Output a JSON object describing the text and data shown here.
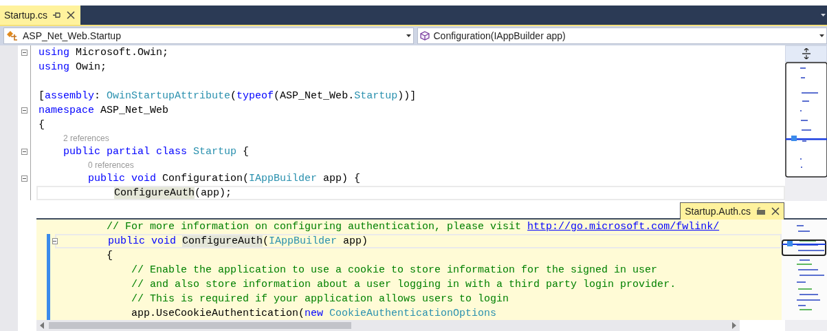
{
  "tabs": [
    {
      "label": "Startup.cs",
      "selected": true,
      "pinned": false
    }
  ],
  "navigation": {
    "type_dropdown": "ASP_Net_Web.Startup",
    "member_dropdown": "Configuration(IAppBuilder app)"
  },
  "editor": {
    "lines": [
      {
        "kind": "code",
        "fold": true,
        "current": false,
        "tokens": [
          {
            "kind": "keyword",
            "text": "using"
          },
          {
            "kind": "plain",
            "text": " Microsoft.Owin;"
          }
        ]
      },
      {
        "kind": "code",
        "fold": false,
        "current": false,
        "tokens": [
          {
            "kind": "keyword",
            "text": "using"
          },
          {
            "kind": "plain",
            "text": " Owin;"
          }
        ]
      },
      {
        "kind": "blank"
      },
      {
        "kind": "code",
        "fold": false,
        "current": false,
        "tokens": [
          {
            "kind": "plain",
            "text": "["
          },
          {
            "kind": "keyword",
            "text": "assembly"
          },
          {
            "kind": "plain",
            "text": ": "
          },
          {
            "kind": "type",
            "text": "OwinStartupAttribute"
          },
          {
            "kind": "plain",
            "text": "("
          },
          {
            "kind": "keyword",
            "text": "typeof"
          },
          {
            "kind": "plain",
            "text": "(ASP_Net_Web."
          },
          {
            "kind": "type",
            "text": "Startup"
          },
          {
            "kind": "plain",
            "text": "))]"
          }
        ]
      },
      {
        "kind": "code",
        "fold": true,
        "current": false,
        "tokens": [
          {
            "kind": "keyword",
            "text": "namespace"
          },
          {
            "kind": "plain",
            "text": " ASP_Net_Web"
          }
        ]
      },
      {
        "kind": "code",
        "fold": false,
        "current": false,
        "tokens": [
          {
            "kind": "plain",
            "text": "{"
          }
        ]
      },
      {
        "kind": "lens",
        "text": "    2 references"
      },
      {
        "kind": "code",
        "fold": true,
        "current": false,
        "tokens": [
          {
            "kind": "keyword",
            "text": "    public partial class "
          },
          {
            "kind": "type",
            "text": "Startup"
          },
          {
            "kind": "plain",
            "text": " {"
          }
        ]
      },
      {
        "kind": "lens",
        "text": "        0 references"
      },
      {
        "kind": "code",
        "fold": true,
        "current": false,
        "tokens": [
          {
            "kind": "keyword",
            "text": "        public void"
          },
          {
            "kind": "plain",
            "text": " Configuration("
          },
          {
            "kind": "type",
            "text": "IAppBuilder"
          },
          {
            "kind": "plain",
            "text": " app) {"
          }
        ]
      },
      {
        "kind": "code",
        "fold": false,
        "current": true,
        "tokens": [
          {
            "kind": "highlight",
            "text": "            ConfigureAuth"
          },
          {
            "kind": "plain",
            "text": "(app);"
          }
        ]
      }
    ]
  },
  "peek": {
    "tab": {
      "label": "Startup.Auth.cs"
    },
    "lines": [
      {
        "kind": "code",
        "fold": false,
        "changed": false,
        "current": false,
        "tokens": [
          {
            "kind": "comment",
            "text": "        // For more information on configuring authentication, please visit "
          },
          {
            "kind": "link",
            "text": "http://go.microsoft.com/fwlink/"
          }
        ]
      },
      {
        "kind": "code",
        "fold": true,
        "changed": true,
        "current": true,
        "tokens": [
          {
            "kind": "keyword",
            "text": "        public void "
          },
          {
            "kind": "highlight",
            "text": "ConfigureAuth"
          },
          {
            "kind": "plain",
            "text": "("
          },
          {
            "kind": "type",
            "text": "IAppBuilder"
          },
          {
            "kind": "plain",
            "text": " app)"
          }
        ]
      },
      {
        "kind": "code",
        "fold": false,
        "changed": true,
        "current": false,
        "tokens": [
          {
            "kind": "plain",
            "text": "        {"
          }
        ]
      },
      {
        "kind": "code",
        "fold": false,
        "changed": true,
        "current": false,
        "tokens": [
          {
            "kind": "comment",
            "text": "            // Enable the application to use a cookie to store information for the signed in user"
          }
        ]
      },
      {
        "kind": "code",
        "fold": false,
        "changed": true,
        "current": false,
        "tokens": [
          {
            "kind": "comment",
            "text": "            // and also store information about a user logging in with a third party login provider."
          }
        ]
      },
      {
        "kind": "code",
        "fold": false,
        "changed": true,
        "current": false,
        "tokens": [
          {
            "kind": "comment",
            "text": "            // This is required if your application allows users to login"
          }
        ]
      },
      {
        "kind": "code",
        "fold": false,
        "changed": true,
        "current": false,
        "tokens": [
          {
            "kind": "plain",
            "text": "            app.UseCookieAuthentication("
          },
          {
            "kind": "keyword",
            "text": "new "
          },
          {
            "kind": "type",
            "text": "CookieAuthenticationOptions"
          }
        ]
      }
    ]
  }
}
